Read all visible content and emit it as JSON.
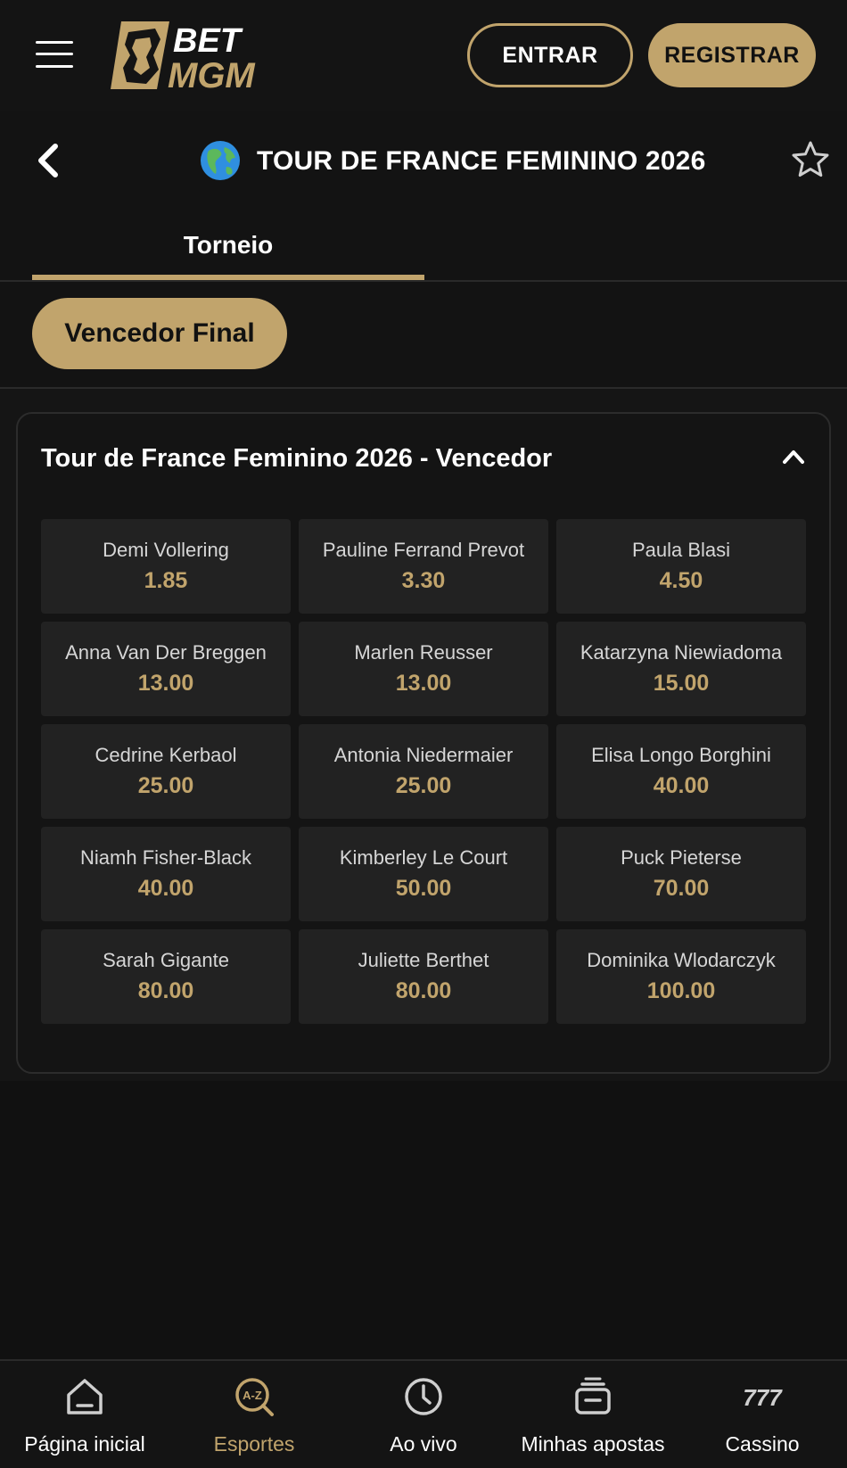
{
  "header": {
    "logo_text_line1": "BET",
    "logo_text_line2": "MGM",
    "login_label": "ENTRAR",
    "register_label": "REGISTRAR",
    "accent_color": "#c1a46c"
  },
  "event": {
    "title": "TOUR DE FRANCE FEMININO 2026",
    "icon": "globe-icon"
  },
  "tabs": [
    {
      "label": "Torneio",
      "active": true
    }
  ],
  "market_filter": {
    "label": "Vencedor Final"
  },
  "market": {
    "title": "Tour de France Feminino 2026 - Vencedor",
    "expanded": true,
    "selections": [
      {
        "name": "Demi Vollering",
        "odds": "1.85"
      },
      {
        "name": "Pauline Ferrand Prevot",
        "odds": "3.30"
      },
      {
        "name": "Paula Blasi",
        "odds": "4.50"
      },
      {
        "name": "Anna Van Der Breggen",
        "odds": "13.00"
      },
      {
        "name": "Marlen Reusser",
        "odds": "13.00"
      },
      {
        "name": "Katarzyna Niewiadoma",
        "odds": "15.00"
      },
      {
        "name": "Cedrine Kerbaol",
        "odds": "25.00"
      },
      {
        "name": "Antonia Niedermaier",
        "odds": "25.00"
      },
      {
        "name": "Elisa Longo Borghini",
        "odds": "40.00"
      },
      {
        "name": "Niamh Fisher-Black",
        "odds": "40.00"
      },
      {
        "name": "Kimberley Le Court",
        "odds": "50.00"
      },
      {
        "name": "Puck Pieterse",
        "odds": "70.00"
      },
      {
        "name": "Sarah Gigante",
        "odds": "80.00"
      },
      {
        "name": "Juliette Berthet",
        "odds": "80.00"
      },
      {
        "name": "Dominika Wlodarczyk",
        "odds": "100.00"
      }
    ]
  },
  "bottom_nav": [
    {
      "label": "Página inicial",
      "icon": "home-icon",
      "active": false
    },
    {
      "label": "Esportes",
      "icon": "a-z-search-icon",
      "active": true
    },
    {
      "label": "Ao vivo",
      "icon": "clock-icon",
      "active": false
    },
    {
      "label": "Minhas apostas",
      "icon": "bet-slip-icon",
      "active": false
    },
    {
      "label": "Cassino",
      "icon": "777-icon",
      "active": false
    }
  ]
}
